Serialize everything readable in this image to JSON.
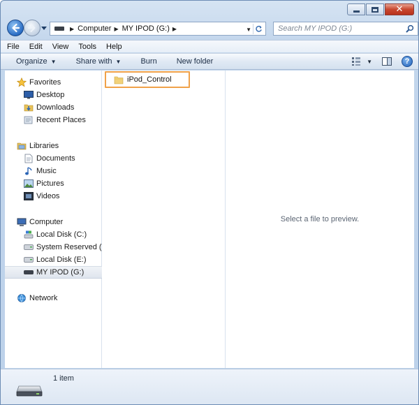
{
  "address": {
    "crumbs": [
      "Computer",
      "MY IPOD (G:)"
    ]
  },
  "search": {
    "placeholder": "Search MY IPOD (G:)"
  },
  "menu": [
    "File",
    "Edit",
    "View",
    "Tools",
    "Help"
  ],
  "commands": {
    "organize": "Organize",
    "share_with": "Share with",
    "burn": "Burn",
    "new_folder": "New folder"
  },
  "nav": {
    "favorites": {
      "label": "Favorites",
      "items": [
        "Desktop",
        "Downloads",
        "Recent Places"
      ]
    },
    "libraries": {
      "label": "Libraries",
      "items": [
        "Documents",
        "Music",
        "Pictures",
        "Videos"
      ]
    },
    "computer": {
      "label": "Computer",
      "items": [
        "Local Disk (C:)",
        "System Reserved (D:",
        "Local Disk (E:)",
        "MY IPOD (G:)"
      ]
    },
    "network": {
      "label": "Network"
    }
  },
  "content": {
    "items": [
      {
        "name": "iPod_Control",
        "highlight_color": "#f0a24a"
      }
    ]
  },
  "preview": {
    "message": "Select a file to preview."
  },
  "details": {
    "count": "1 item"
  },
  "colors": {
    "selection_outline": "#f0a24a",
    "frame": "#bcd1ea",
    "close_button": "#c8472f"
  }
}
